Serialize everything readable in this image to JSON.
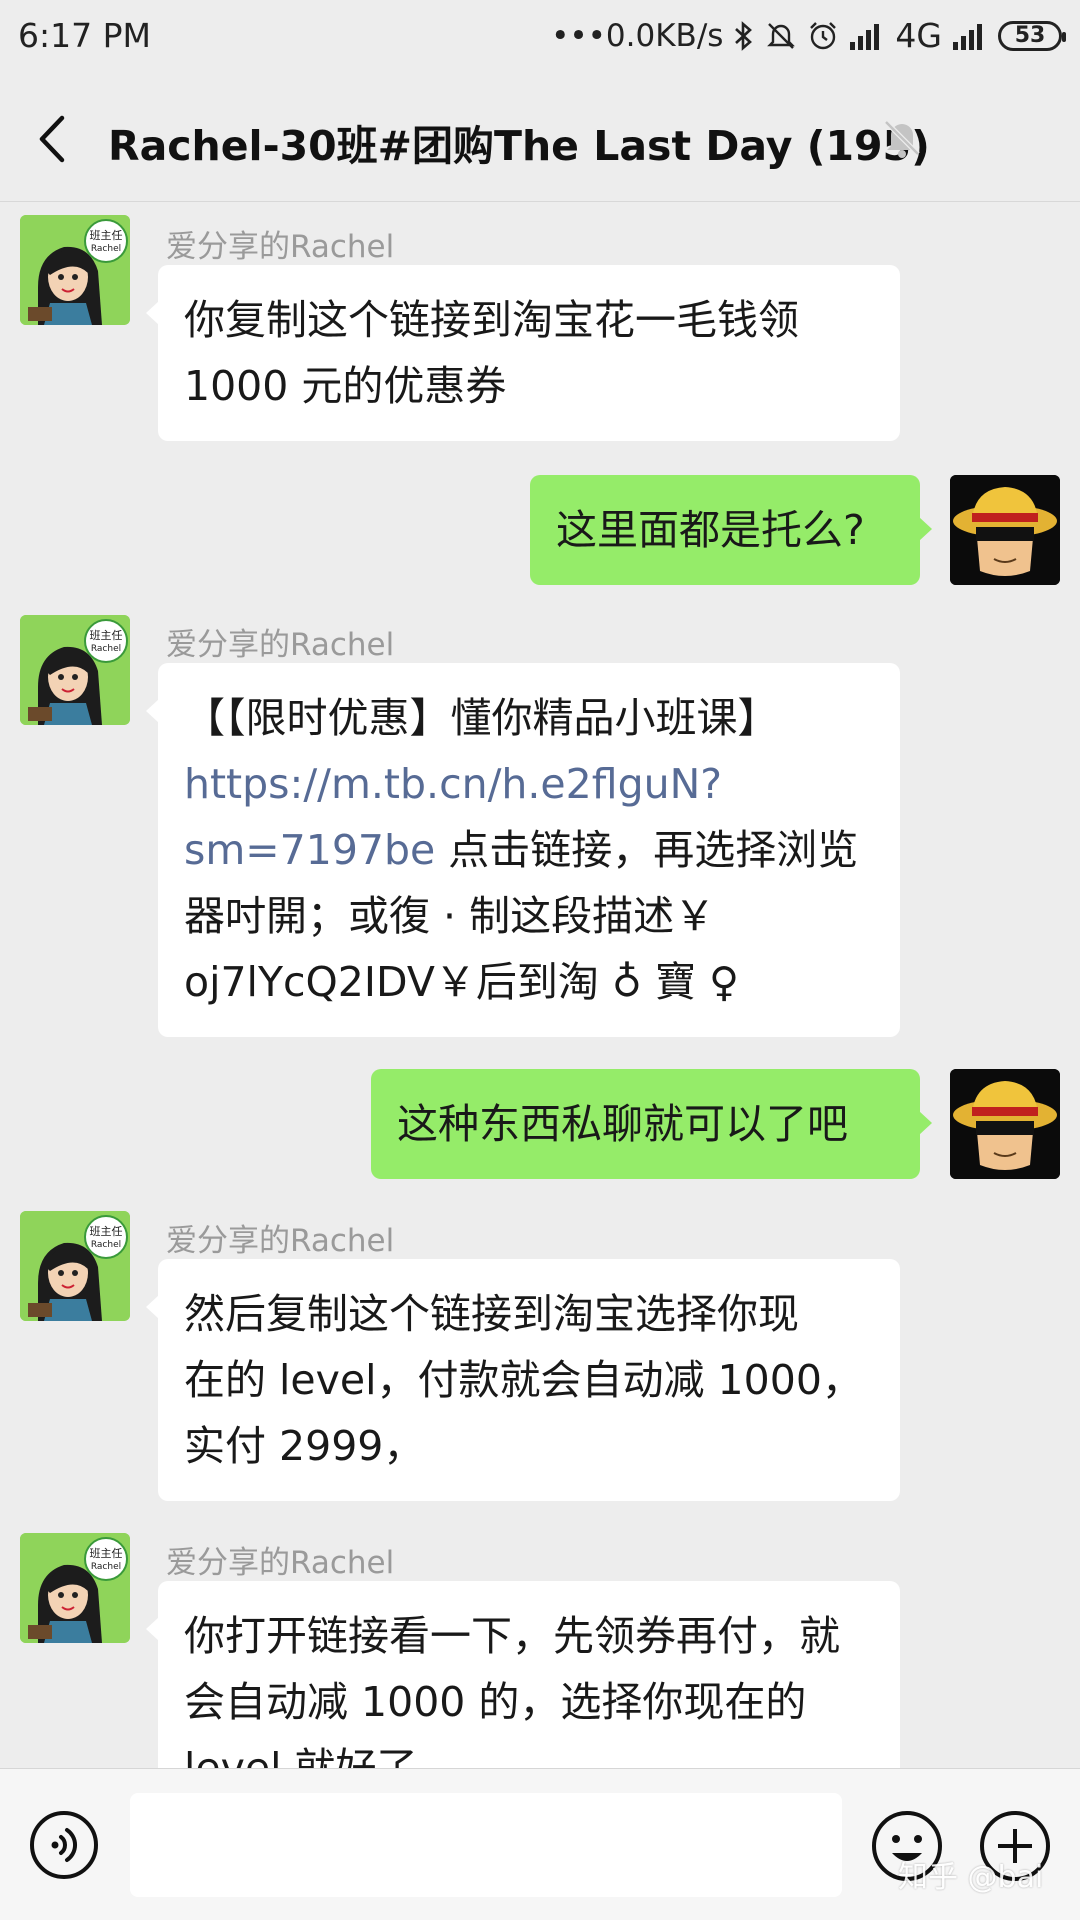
{
  "status_bar": {
    "time": "6:17 PM",
    "network_speed": "•••0.0KB/s",
    "network_type": "4G",
    "battery": "53"
  },
  "header": {
    "title": "Rachel-30班#团购The Last Day (195)",
    "back_icon": "chevron-left-icon",
    "mute_icon": "bell-muted-icon"
  },
  "messages": [
    {
      "side": "left",
      "sender": "爱分享的Rachel",
      "lines": [
        "你复制这个链接到淘宝花一毛钱领",
        "1000 元的优惠券"
      ]
    },
    {
      "side": "right",
      "lines": [
        "这里面都是托么?"
      ]
    },
    {
      "side": "left",
      "sender": "爱分享的Rachel",
      "line1": "【【限时优惠】懂你精品小班课】",
      "link1": "https://m.tb.cn/h.e2flguN?",
      "link2": "sm=7197be",
      "after_link": " 点击链接，再选择浏览",
      "line4": "器吋開；或復 · 制这段描述￥",
      "line5": "oj7lYcQ2IDV￥后到淘 ♁ 寶 ♀"
    },
    {
      "side": "right",
      "lines": [
        "这种东西私聊就可以了吧"
      ]
    },
    {
      "side": "left",
      "sender": "爱分享的Rachel",
      "lines": [
        "然后复制这个链接到淘宝选择你现",
        "在的 level，付款就会自动减 1000，",
        "实付 2999，"
      ]
    },
    {
      "side": "left",
      "sender": "爱分享的Rachel",
      "lines": [
        "你打开链接看一下，先领券再付，就",
        "会自动减 1000 的，选择你现在的",
        "level 就好了"
      ]
    }
  ],
  "avatar": {
    "badge_line1": "班主任",
    "badge_line2": "Rachel"
  },
  "input_bar": {
    "voice_icon": "voice-icon",
    "emoji_icon": "emoji-icon",
    "plus_icon": "plus-icon"
  },
  "watermark": "知乎 @bai",
  "colors": {
    "background": "#ededed",
    "bubble_self": "#95ec69",
    "bubble_other": "#ffffff",
    "link": "#576b95",
    "sender_name": "#9a9a9a"
  }
}
